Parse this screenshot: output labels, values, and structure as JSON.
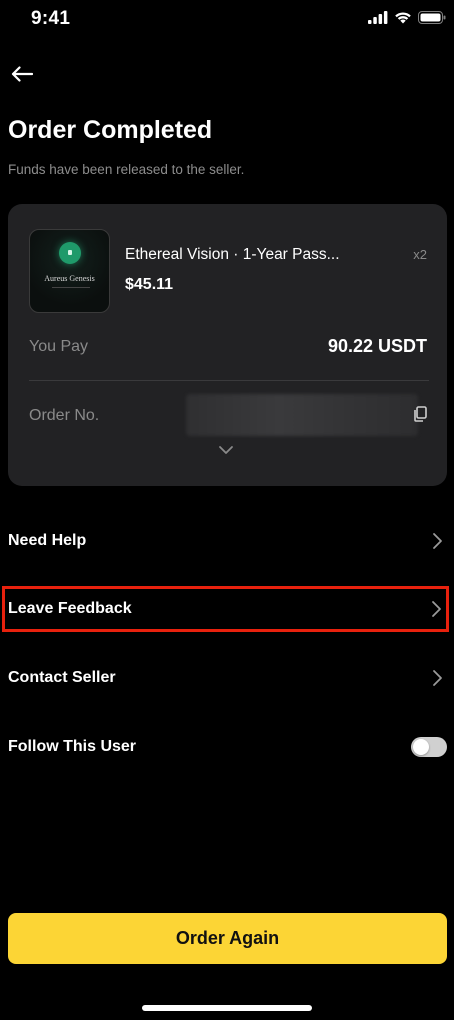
{
  "status_bar": {
    "time": "9:41"
  },
  "header": {
    "title": "Order Completed",
    "subtitle": "Funds have been released to the seller."
  },
  "order": {
    "thumbnail_text": "Aureus Genesis",
    "product_name": "Ethereal Vision · 1-Year Pass...",
    "quantity": "x2",
    "price": "$45.11",
    "you_pay_label": "You Pay",
    "you_pay_value": "90.22 USDT",
    "order_no_label": "Order No."
  },
  "menu": {
    "need_help": "Need Help",
    "leave_feedback": "Leave Feedback",
    "contact_seller": "Contact Seller",
    "follow_user": "Follow This User",
    "follow_enabled": false
  },
  "actions": {
    "order_again": "Order Again"
  },
  "colors": {
    "accent": "#fcd535",
    "highlight": "#e8210d",
    "card": "#222224"
  }
}
